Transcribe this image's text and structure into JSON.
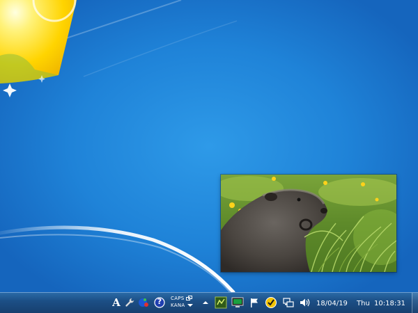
{
  "taskbar": {
    "ime": {
      "caps_label": "CAPS",
      "kana_label": "KANA"
    },
    "clock": {
      "date": "18/04/19",
      "day": "Thu",
      "time": "10:18:31"
    }
  },
  "icons": {
    "ime_mode": "A",
    "help": "?"
  },
  "colors": {
    "desktop": "#1f7fd4",
    "taskbar": "#1c4f86",
    "sun": "#ffe020"
  }
}
